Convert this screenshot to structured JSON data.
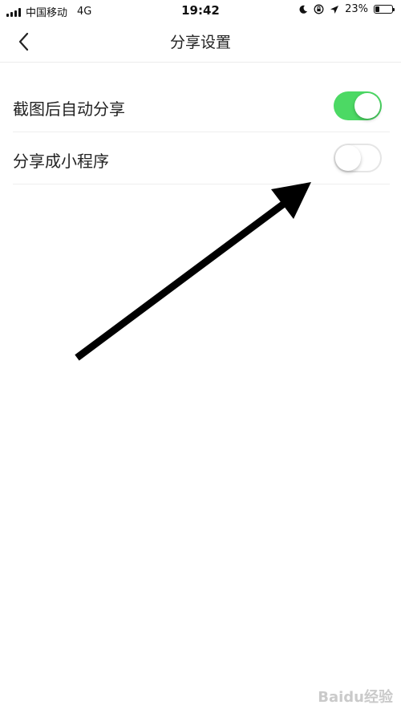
{
  "status_bar": {
    "carrier": "中国移动",
    "network": "4G",
    "time": "19:42",
    "battery_percent": "23%",
    "battery_level": 0.23
  },
  "nav": {
    "title": "分享设置",
    "back_icon": "chevron-left-icon"
  },
  "settings": [
    {
      "label": "截图后自动分享",
      "enabled": true
    },
    {
      "label": "分享成小程序",
      "enabled": false
    }
  ],
  "colors": {
    "toggle_on": "#4cd964",
    "toggle_off_border": "#e5e5e5",
    "arrow": "#000000"
  },
  "watermark": "Baidu经验"
}
